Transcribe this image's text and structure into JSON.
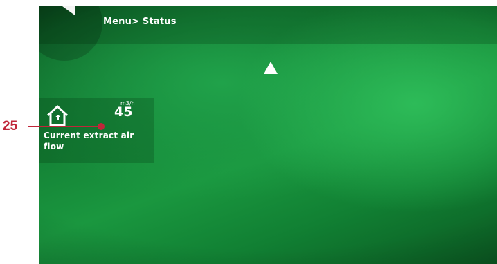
{
  "header": {
    "breadcrumb": "Menu> Status",
    "back_icon": "back-arrow-icon"
  },
  "navigation": {
    "up_icon": "up-triangle-icon"
  },
  "status_tile": {
    "icon": "house-extract-air-icon",
    "unit": "m3/h",
    "value": "45",
    "label": "Current extract air flow"
  },
  "callout": {
    "number": "25",
    "color": "#c0263a"
  },
  "colors": {
    "background_green": "#1a973f",
    "text": "#ffffff"
  }
}
